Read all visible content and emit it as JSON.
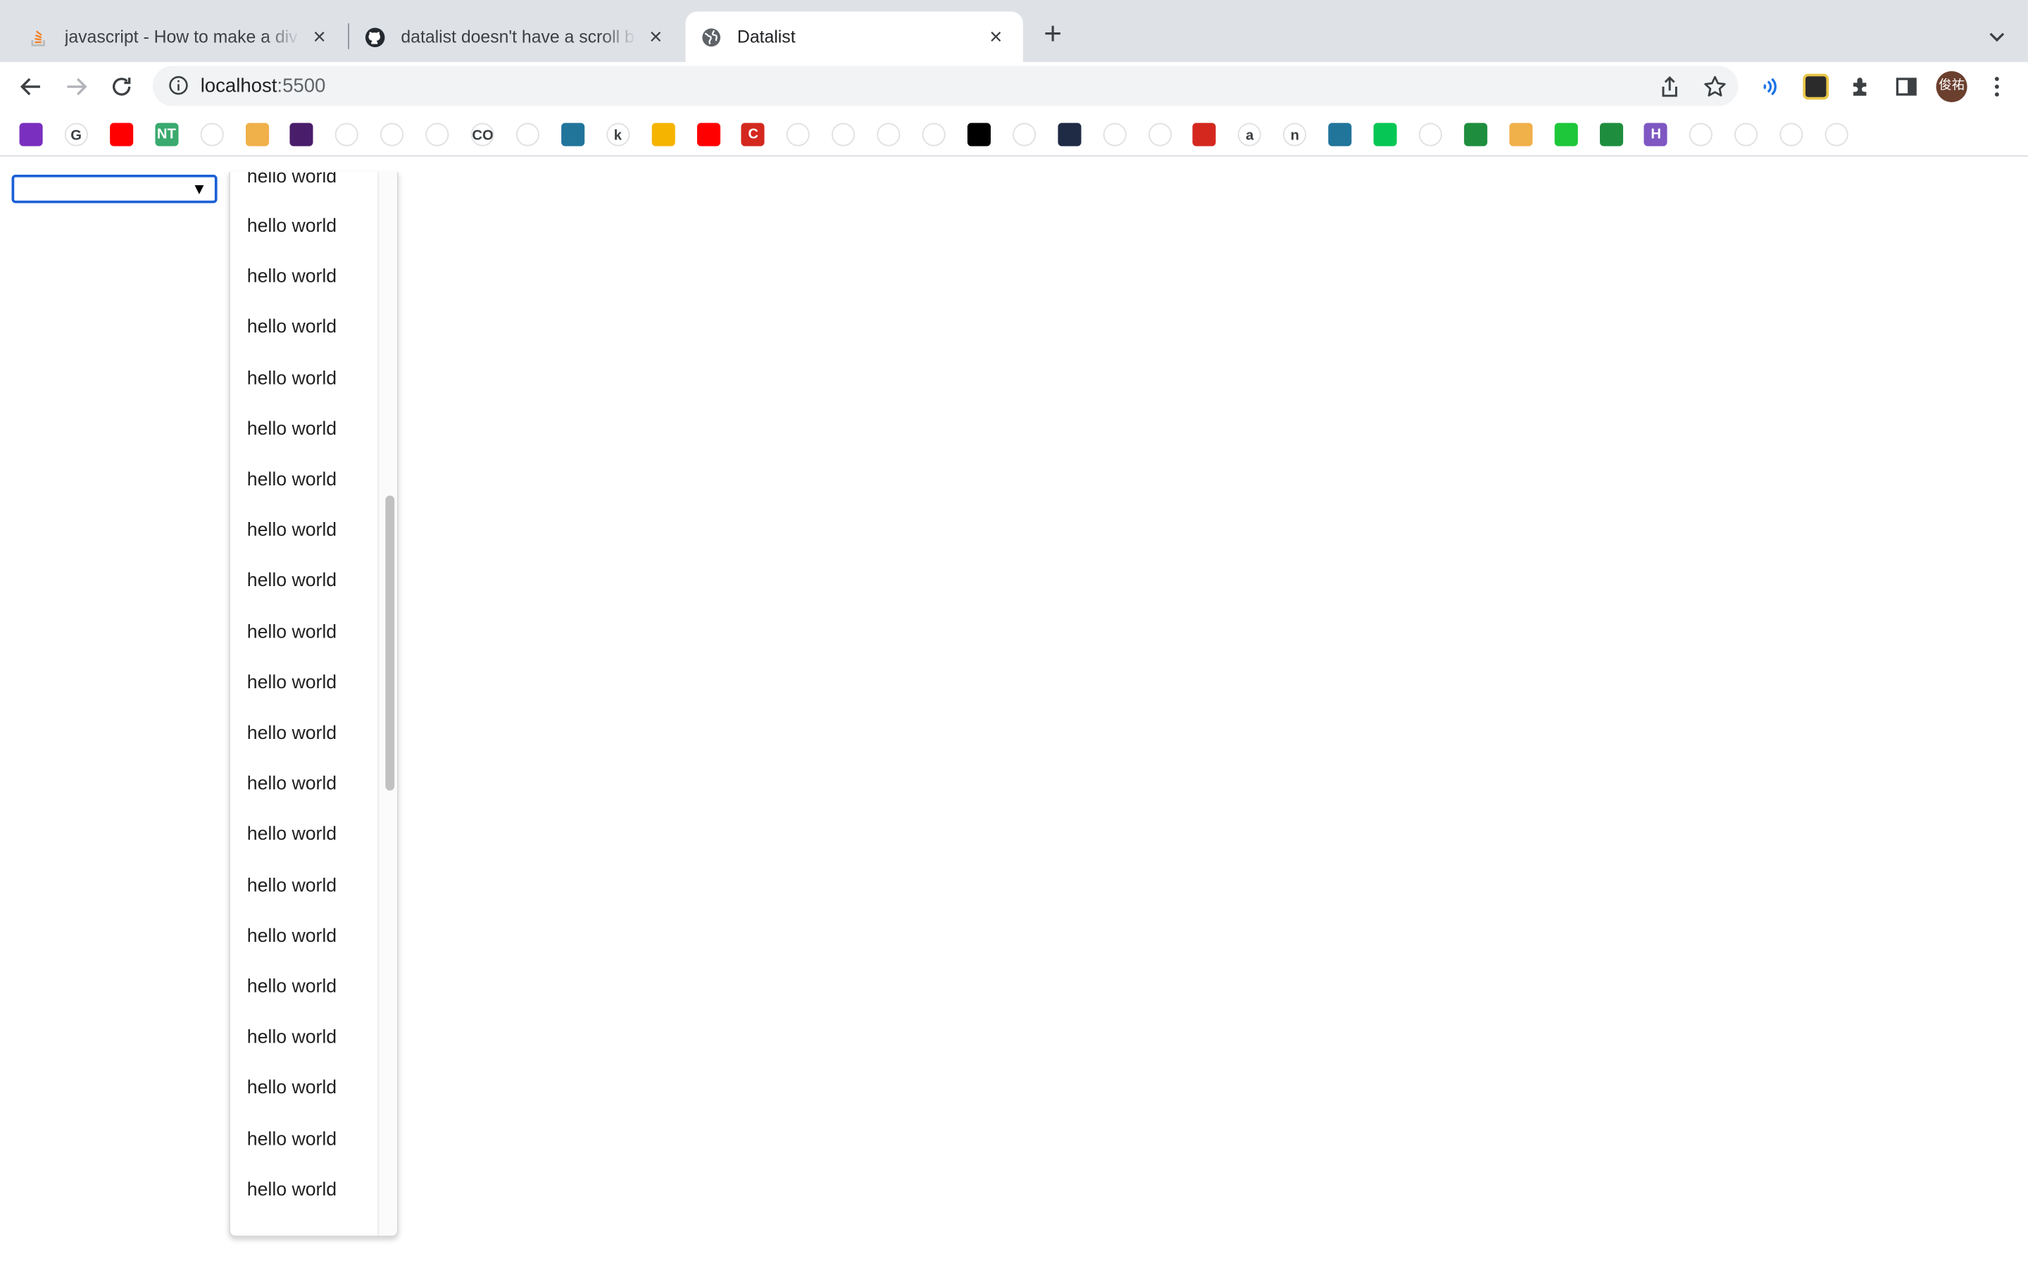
{
  "tabs": [
    {
      "title": "javascript - How to make a div",
      "icon": "stackoverflow-icon"
    },
    {
      "title": "datalist doesn't have a scroll bar",
      "icon": "github-icon"
    },
    {
      "title": "Datalist",
      "icon": "globe-icon",
      "active": true
    }
  ],
  "omnibox": {
    "host": "localhost",
    "port": ":5500"
  },
  "profile": {
    "initials": "俊祐"
  },
  "datalist": {
    "value": "",
    "options": [
      "hello world",
      "hello world",
      "hello world",
      "hello world",
      "hello world",
      "hello world",
      "hello world",
      "hello world",
      "hello world",
      "hello world",
      "hello world",
      "hello world",
      "hello world",
      "hello world",
      "hello world",
      "hello world",
      "hello world",
      "hello world",
      "hello world",
      "hello world"
    ],
    "partial_option": "hello world",
    "scroll_position_fraction": 0.3
  },
  "bookmarks": [
    {
      "icon": "purple-circle-icon",
      "label": "",
      "color": "#7b2fbe"
    },
    {
      "icon": "google-icon",
      "label": "G",
      "color": "#ffffff"
    },
    {
      "icon": "youtube-icon",
      "label": "",
      "color": "#ff0000"
    },
    {
      "icon": "nt-icon",
      "label": "NT",
      "color": "#3aaa6f"
    },
    {
      "icon": "triangle-icon",
      "label": "",
      "color": "#ffffff"
    },
    {
      "icon": "search-doc-icon",
      "label": "",
      "color": "#f0b04a"
    },
    {
      "icon": "purple-square-icon",
      "label": "",
      "color": "#4a1d6b"
    },
    {
      "icon": "blue-a-icon",
      "label": "",
      "color": "#ffffff"
    },
    {
      "icon": "globe-icon",
      "label": "",
      "color": "#ffffff"
    },
    {
      "icon": "globe-icon",
      "label": "",
      "color": "#ffffff"
    },
    {
      "icon": "co-icon",
      "label": "CO",
      "color": "#ffffff"
    },
    {
      "icon": "drive-icon",
      "label": "",
      "color": "#ffffff"
    },
    {
      "icon": "wordpress-icon",
      "label": "",
      "color": "#21759b"
    },
    {
      "icon": "k-icon",
      "label": "k",
      "color": "#ffffff"
    },
    {
      "icon": "slides-icon",
      "label": "",
      "color": "#f4b400"
    },
    {
      "icon": "youtube-icon",
      "label": "",
      "color": "#ff0000"
    },
    {
      "icon": "red-c-icon",
      "label": "C",
      "color": "#d4281f"
    },
    {
      "icon": "pinwheel-icon",
      "label": "",
      "color": "#ffffff"
    },
    {
      "icon": "globe-icon",
      "label": "",
      "color": "#ffffff"
    },
    {
      "icon": "ai-mall-icon",
      "label": "",
      "color": "#ffffff"
    },
    {
      "icon": "globe-icon",
      "label": "",
      "color": "#ffffff"
    },
    {
      "icon": "black-triangle-icon",
      "label": "",
      "color": "#000000"
    },
    {
      "icon": "puzzle-icon",
      "label": "",
      "color": "#ffffff"
    },
    {
      "icon": "hex-icon",
      "label": "",
      "color": "#1f2a44"
    },
    {
      "icon": "book-icon",
      "label": "",
      "color": "#ffffff"
    },
    {
      "icon": "rainbow-icon",
      "label": "",
      "color": "#ffffff"
    },
    {
      "icon": "red-grid-icon",
      "label": "",
      "color": "#d4281f"
    },
    {
      "icon": "amazon-icon",
      "label": "a",
      "color": "#ffffff"
    },
    {
      "icon": "n-icon",
      "label": "n",
      "color": "#ffffff"
    },
    {
      "icon": "wordpress-icon",
      "label": "",
      "color": "#21759b"
    },
    {
      "icon": "line-icon",
      "label": "",
      "color": "#06c755"
    },
    {
      "icon": "fan-icon",
      "label": "",
      "color": "#ffffff"
    },
    {
      "icon": "green-plus-icon",
      "label": "",
      "color": "#1e8e3e"
    },
    {
      "icon": "face-icon",
      "label": "",
      "color": "#f0b04a"
    },
    {
      "icon": "green-c-icon",
      "label": "",
      "color": "#1ec73a"
    },
    {
      "icon": "green-mail-icon",
      "label": "",
      "color": "#1e8e3e"
    },
    {
      "icon": "h-icon",
      "label": "H",
      "color": "#7e57c2"
    },
    {
      "icon": "slash-icon",
      "label": "",
      "color": "#ffffff"
    },
    {
      "icon": "fish-icon",
      "label": "",
      "color": "#ffffff"
    },
    {
      "icon": "ring-icon",
      "label": "",
      "color": "#ffffff"
    },
    {
      "icon": "colored-blocks-icon",
      "label": "",
      "color": "#ffffff"
    }
  ]
}
